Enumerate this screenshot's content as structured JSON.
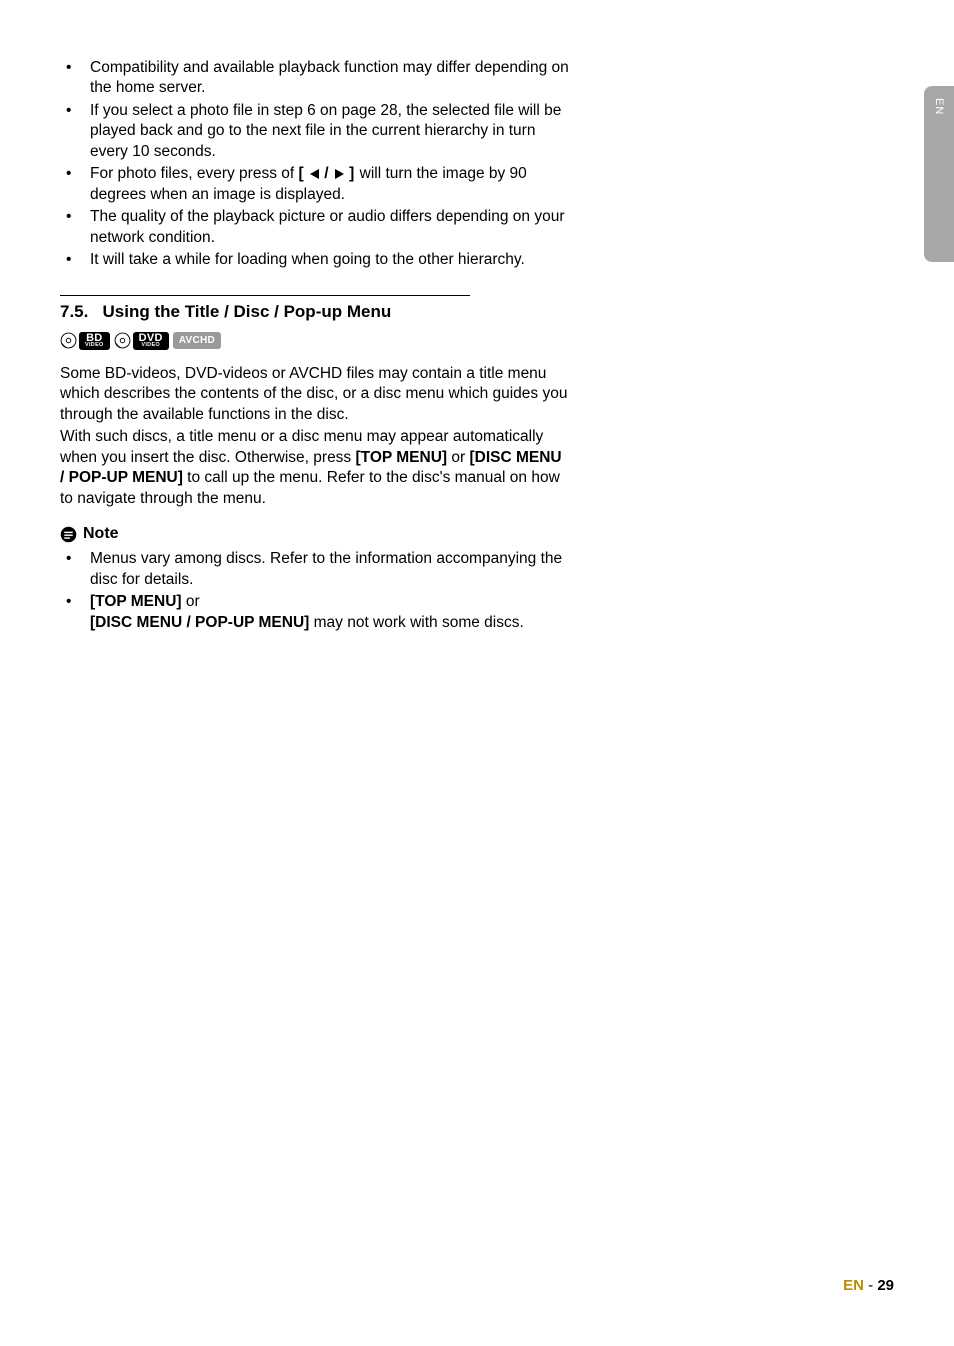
{
  "sideTab": "EN",
  "bullets1": [
    "Compatibility and available playback function may differ depending on the home server.",
    "If you select a photo file in step 6 on page 28, the selected file will be played back and go to the next file in the current hierarchy in turn every 10 seconds.",
    {
      "pre": "For photo files, every press of ",
      "post": " will turn the image by 90 degrees when an image is displayed."
    },
    "The quality of the playback picture or audio differs depending on your network condition.",
    "It will take a while for loading when going to the other hierarchy."
  ],
  "section": {
    "number": "7.5.",
    "title": "Using the Title / Disc / Pop-up Menu"
  },
  "badges": {
    "bd": {
      "main": "BD",
      "sub": "VIDEO"
    },
    "dvd": {
      "main": "DVD",
      "sub": "VIDEO"
    },
    "avchd": "AVCHD"
  },
  "para1": "Some BD-videos, DVD-videos or AVCHD files may contain a title menu which describes the contents of the disc, or a disc menu which guides you through the available functions in the disc.",
  "para2_a": "With such discs, a title menu or a disc menu may appear automatically when you insert the disc. Otherwise, press ",
  "para2_b": "[TOP MENU]",
  "para2_c": " or ",
  "para2_d": "[DISC MENU / POP-UP MENU]",
  "para2_e": " to call up the menu. Refer to the disc's manual on how to navigate through the menu.",
  "noteLabel": "Note",
  "noteBullets": [
    "Menus vary among discs. Refer to the information accompanying the disc for details.",
    {
      "a": "[TOP MENU]",
      "b": " or",
      "c": "[DISC MENU / POP-UP MENU]",
      "d": " may not work with some discs."
    }
  ],
  "footer": {
    "lang": "EN",
    "sep": " - ",
    "page": "29"
  }
}
